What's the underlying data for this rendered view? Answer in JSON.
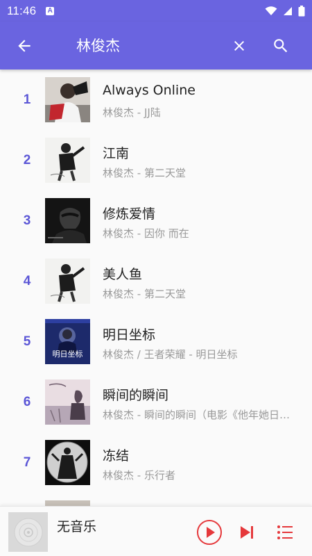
{
  "status_bar": {
    "time": "11:46",
    "indicator": "A"
  },
  "app_bar": {
    "title": "林俊杰"
  },
  "songs": [
    {
      "index": "1",
      "title": "Always Online",
      "subtitle": "林俊杰 - JJ陆"
    },
    {
      "index": "2",
      "title": "江南",
      "subtitle": "林俊杰 - 第二天堂"
    },
    {
      "index": "3",
      "title": "修炼爱情",
      "subtitle": "林俊杰 - 因你 而在"
    },
    {
      "index": "4",
      "title": "美人鱼",
      "subtitle": "林俊杰 - 第二天堂"
    },
    {
      "index": "5",
      "title": "明日坐标",
      "subtitle": "林俊杰 / 王者荣耀 - 明日坐标"
    },
    {
      "index": "6",
      "title": "瞬间的瞬间",
      "subtitle": "林俊杰 - 瞬间的瞬间（电影《他年她日》主题曲）"
    },
    {
      "index": "7",
      "title": "冻结",
      "subtitle": "林俊杰 - 乐行者"
    }
  ],
  "cover_texts": {
    "cover5": "明日坐标"
  },
  "player": {
    "title": "无音乐"
  },
  "colors": {
    "primary": "#6a64e0",
    "accent": "#e5383b",
    "index": "#5b56d6"
  }
}
